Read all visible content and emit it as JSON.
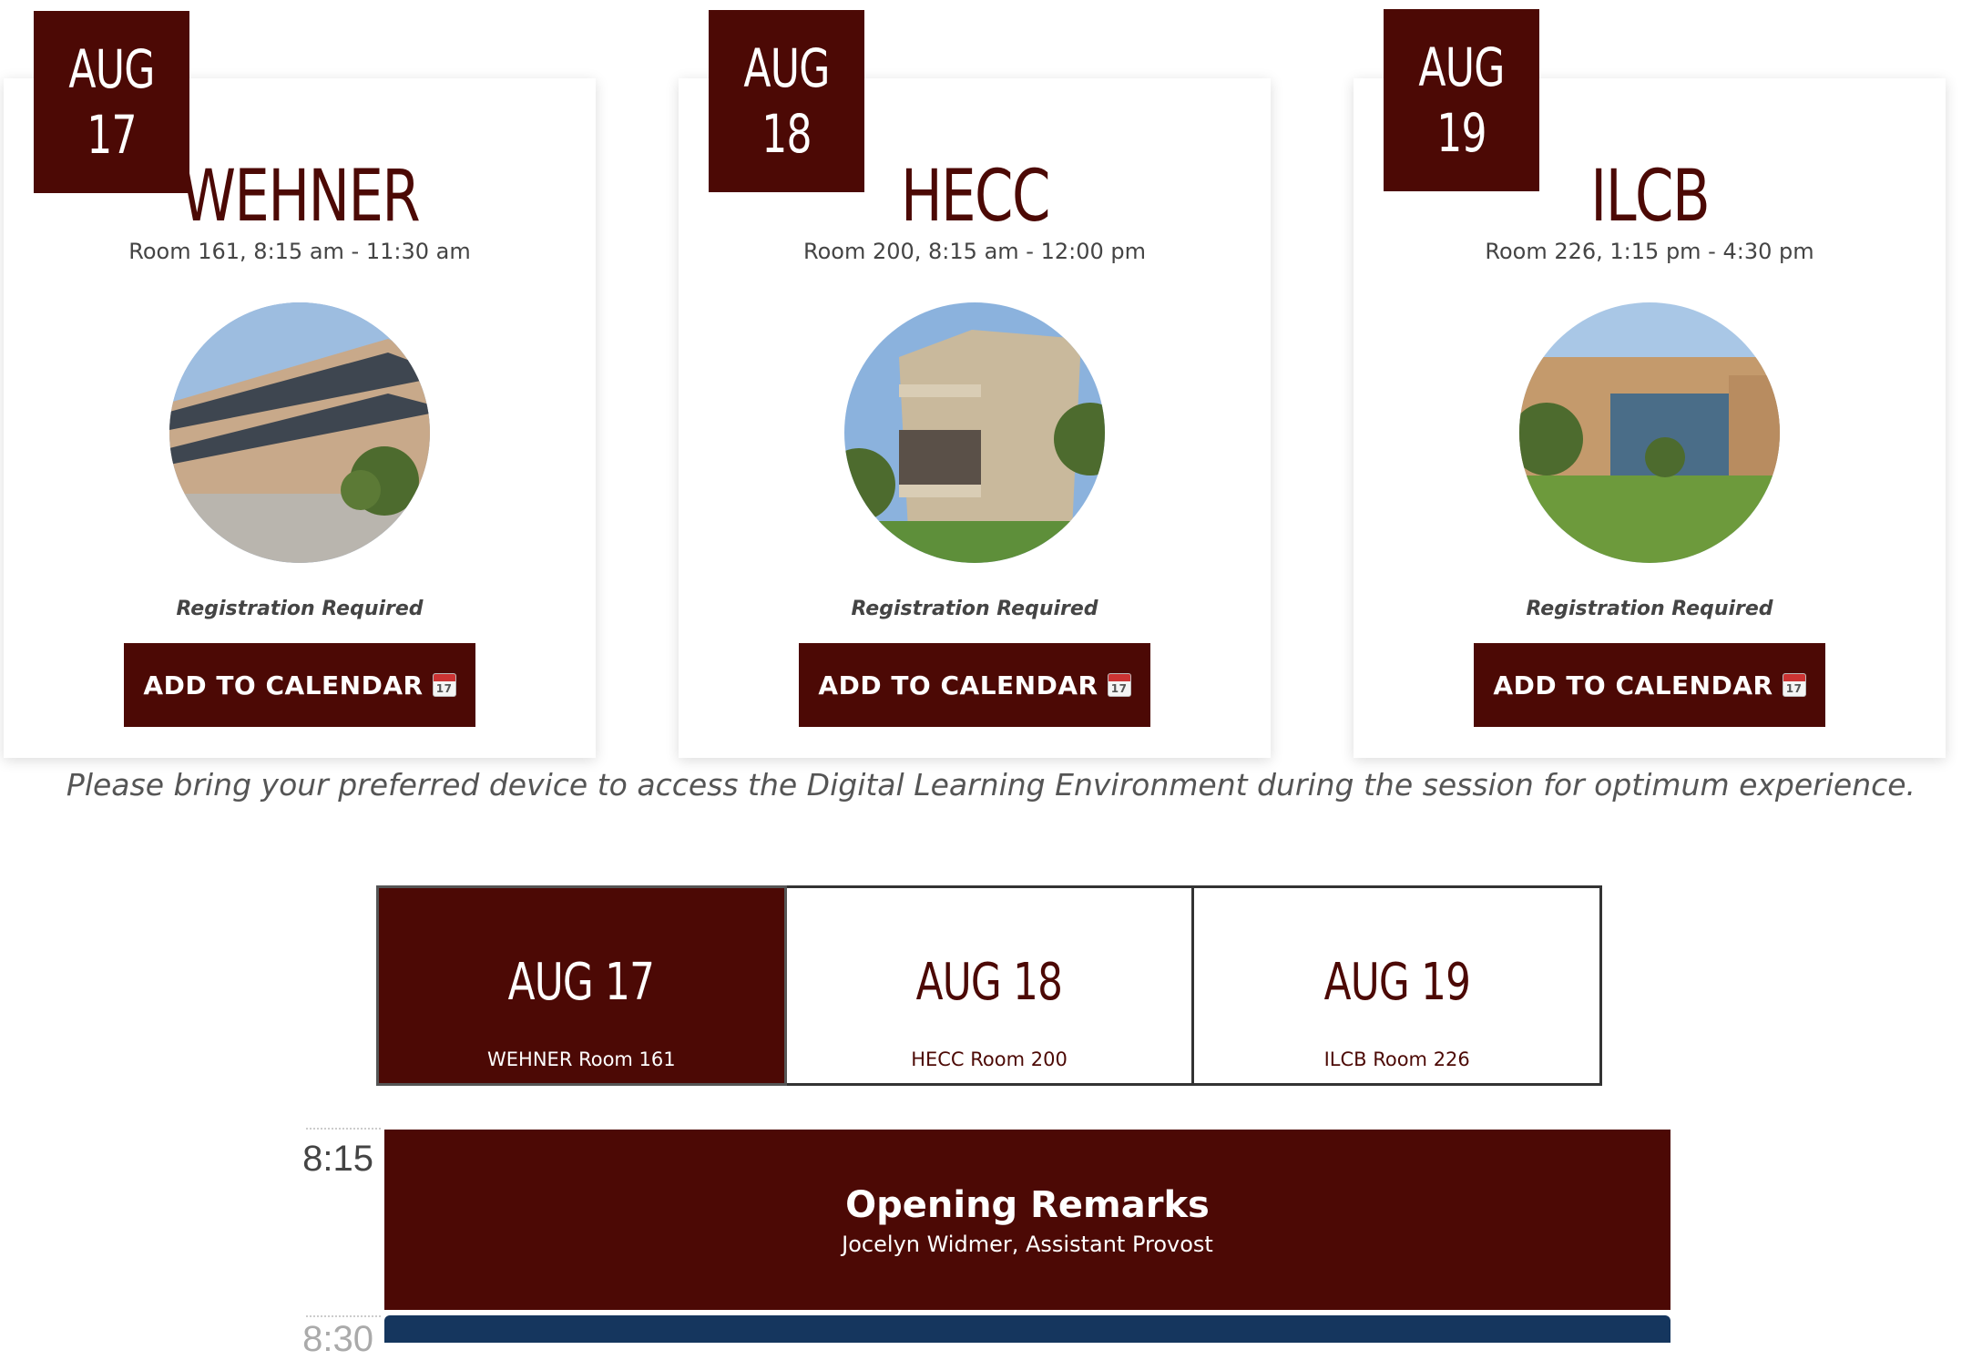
{
  "cards": [
    {
      "month": "AUG",
      "day": "17",
      "venue": "WEHNER",
      "room_time": "Room 161, 8:15 am - 11:30 am",
      "note": "Registration Required",
      "button": "ADD TO CALENDAR",
      "icon": "calendar-icon",
      "icon_day": "17"
    },
    {
      "month": "AUG",
      "day": "18",
      "venue": "HECC",
      "room_time": "Room 200, 8:15 am - 12:00 pm",
      "note": "Registration Required",
      "button": "ADD TO CALENDAR",
      "icon": "calendar-icon",
      "icon_day": "17"
    },
    {
      "month": "AUG",
      "day": "19",
      "venue": "ILCB",
      "room_time": "Room 226, 1:15 pm - 4:30 pm",
      "note": "Registration Required",
      "button": "ADD TO CALENDAR",
      "icon": "calendar-icon",
      "icon_day": "17"
    }
  ],
  "device_note": "Please bring your preferred device to access the Digital Learning Environment during the session for optimum experience.",
  "tabs": [
    {
      "date": "AUG 17",
      "room": "WEHNER Room 161",
      "active": true
    },
    {
      "date": "AUG 18",
      "room": "HECC Room 200",
      "active": false
    },
    {
      "date": "AUG 19",
      "room": "ILCB Room 226",
      "active": false
    }
  ],
  "schedule": {
    "times": [
      "8:15",
      "8:30"
    ],
    "events": [
      {
        "title": "Opening Remarks",
        "subtitle": "Jocelyn Widmer, Assistant Provost"
      }
    ]
  },
  "colors": {
    "maroon": "#4c0905",
    "navy": "#15365e"
  }
}
